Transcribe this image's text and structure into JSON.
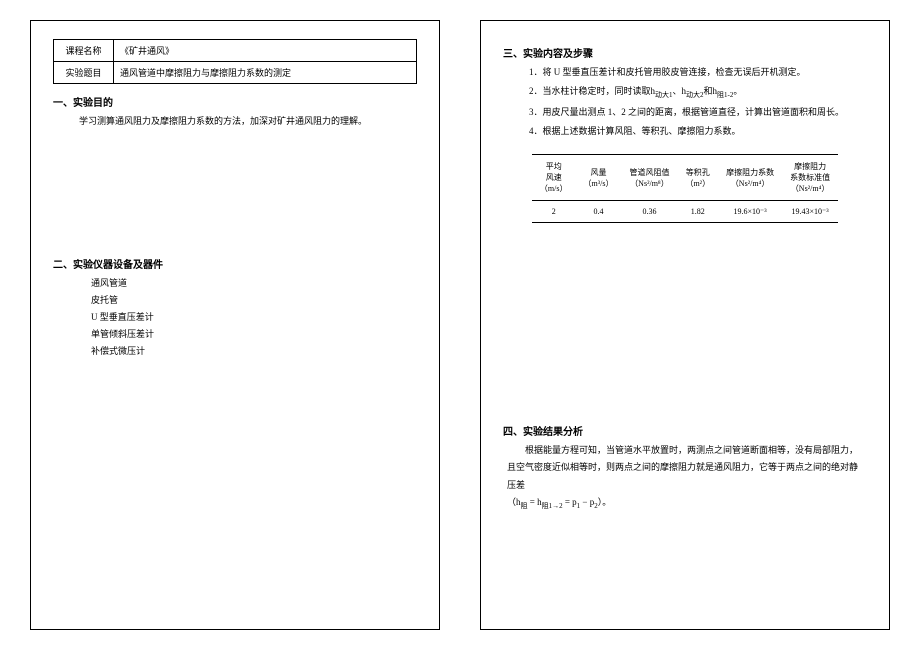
{
  "meta": {
    "course_label": "课程名称",
    "course_value": "《矿井通风》",
    "topic_label": "实验题目",
    "topic_value": "通风管道中摩擦阻力与摩擦阻力系数的测定"
  },
  "sec1": {
    "heading": "一、实验目的",
    "body": "学习测算通风阻力及摩擦阻力系数的方法，加深对矿井通风阻力的理解。"
  },
  "sec2": {
    "heading": "二、实验仪器设备及器件",
    "items": [
      "通风管道",
      "皮托管",
      "U 型垂直压差计",
      "单管倾斜压差计",
      "补偿式微压计"
    ]
  },
  "sec3": {
    "heading": "三、实验内容及步骤",
    "steps": [
      "1．将 U 型垂直压差计和皮托管用胶皮管连接，检查无误后开机测定。",
      "2．当水柱计稳定时，同时读取h",
      "3．用皮尺量出测点 1、2 之间的距离，根据管道直径，计算出管道面积和周长。",
      "4．根据上述数据计算风阻、等积孔、摩擦阻力系数。"
    ],
    "step2_tail_a": "动大1",
    "step2_tail_b": "、h",
    "step2_tail_c": "动大2",
    "step2_tail_d": "和h",
    "step2_tail_e": "阻1-2",
    "step2_tail_f": "。"
  },
  "table": {
    "headers": {
      "c1a": "平均",
      "c1b": "风速",
      "c1c": "（m/s）",
      "c2a": "风量",
      "c2b": "（m³/s）",
      "c3a": "管道风阻值",
      "c3b": "（Ns²/m⁸）",
      "c4a": "等积孔",
      "c4b": "（m²）",
      "c5a": "摩擦阻力系数",
      "c5b": "（Ns²/m⁴）",
      "c6a": "摩擦阻力",
      "c6b": "系数标准值",
      "c6c": "（Ns²/m⁴）"
    },
    "row": {
      "c1": "2",
      "c2": "0.4",
      "c3": "0.36",
      "c4": "1.82",
      "c5": "19.6×10⁻³",
      "c6": "19.43×10⁻³"
    }
  },
  "sec4": {
    "heading": "四、实验结果分析",
    "para": "根据能量方程可知，当管道水平放置时，两测点之间管道断面相等，没有局部阻力，且空气密度近似相等时，则两点之间的摩擦阻力就是通风阻力，它等于两点之间的绝对静压差",
    "formula_a": "（h",
    "formula_b": "阻",
    "formula_c": " = h",
    "formula_d": "阻1→2",
    "formula_e": " = p",
    "formula_f": "1",
    "formula_g": " − p",
    "formula_h": "2",
    "formula_i": "）。"
  }
}
